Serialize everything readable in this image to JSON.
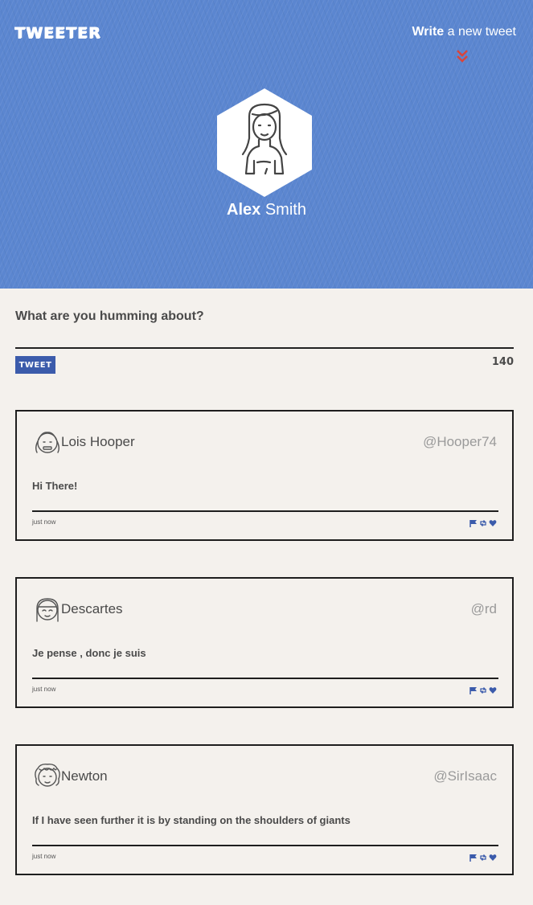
{
  "header": {
    "logo": "TWEETER",
    "write_bold": "Write",
    "write_rest": " a new tweet"
  },
  "profile": {
    "first_name": "Alex",
    "last_name": " Smith"
  },
  "compose": {
    "prompt": "What are you humming about?",
    "button_label": "TWEET",
    "char_count": "140"
  },
  "tweets": [
    {
      "name": "Lois Hooper",
      "handle": "@Hooper74",
      "text": "Hi There!",
      "time": "just now"
    },
    {
      "name": "Descartes",
      "handle": "@rd",
      "text": "Je pense , donc je suis",
      "time": "just now"
    },
    {
      "name": "Newton",
      "handle": "@SirIsaac",
      "text": "If I have seen further it is by standing on the shoulders of giants",
      "time": "just now"
    }
  ],
  "colors": {
    "hero": "#5b86d0",
    "accent": "#3b5bab",
    "chevron": "#d9453b",
    "background": "#f4f1ed"
  }
}
